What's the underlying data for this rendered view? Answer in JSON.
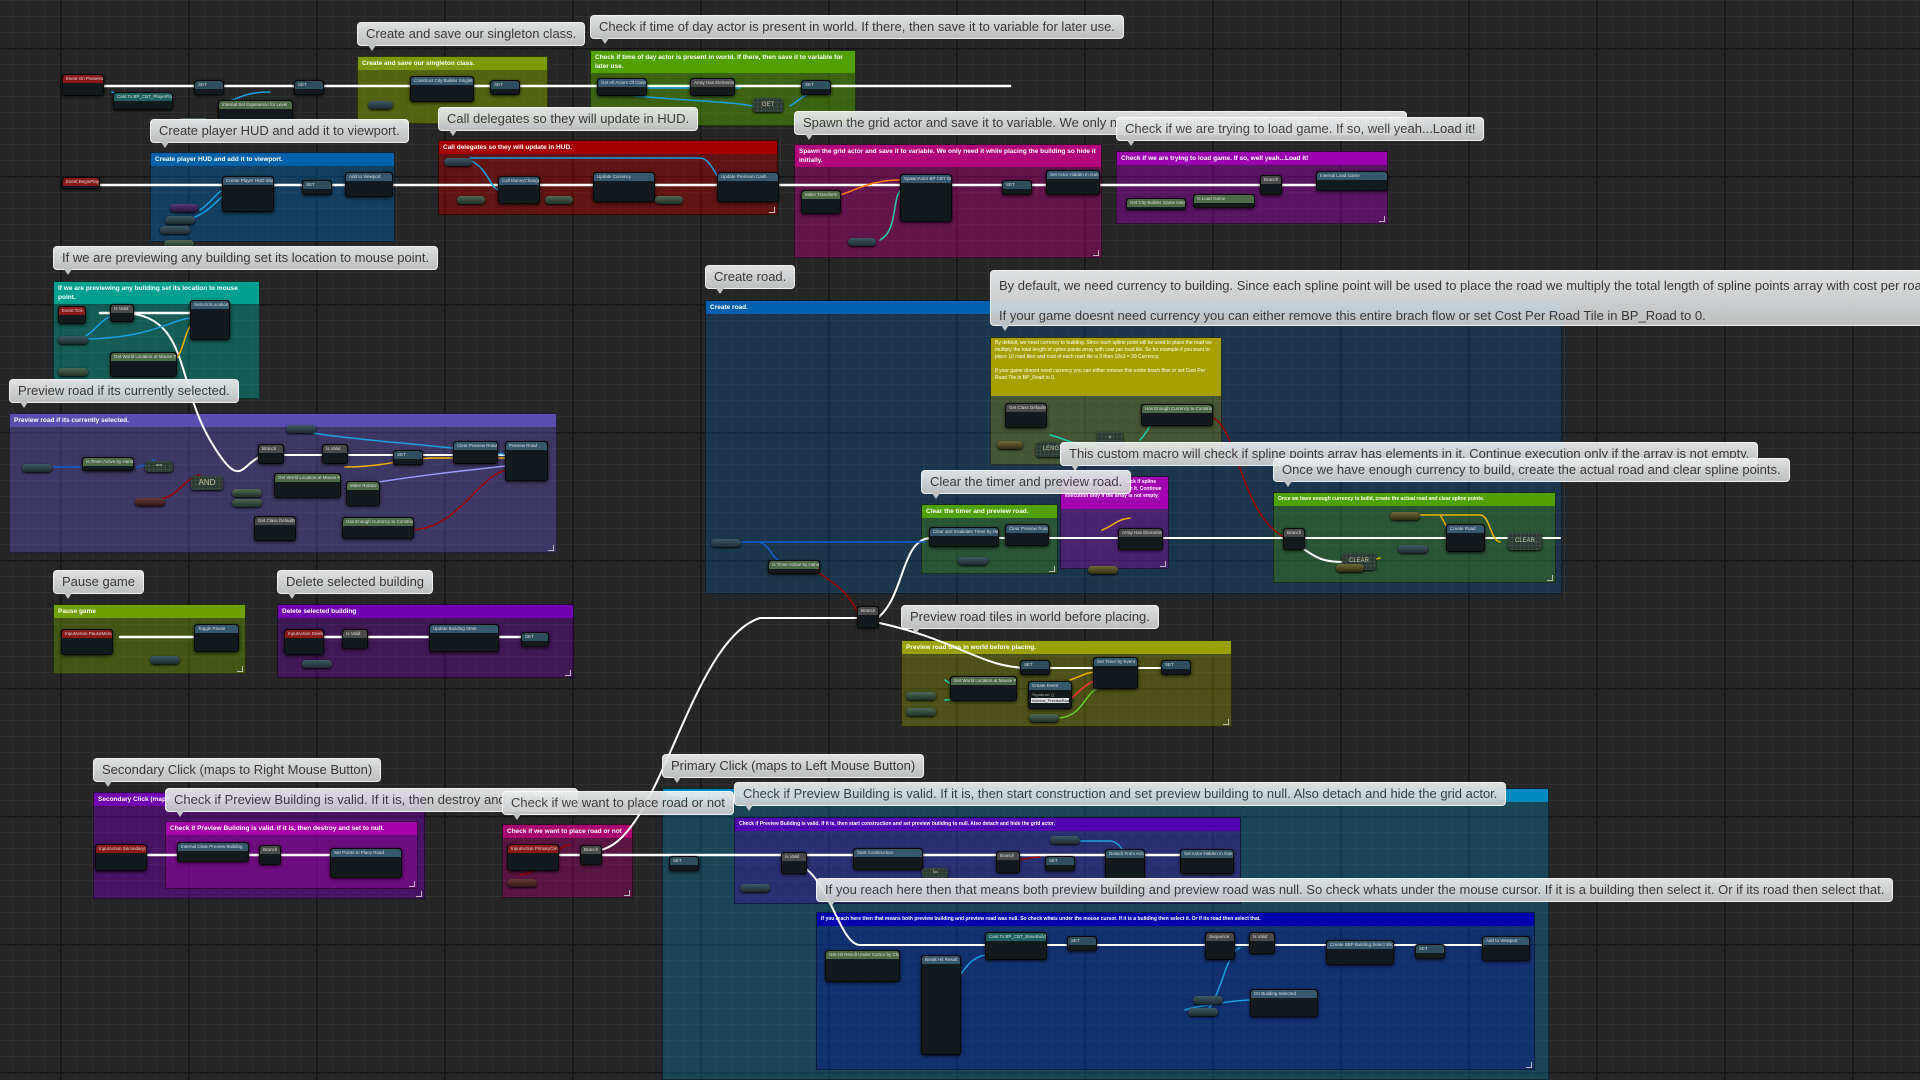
{
  "editor": {
    "type": "blueprint-event-graph"
  },
  "bubbles": [
    "Create and save our singleton class.",
    "Check if time of day actor is present in world. If there, then save it to variable for later use.",
    "Create player HUD and add it to viewport.",
    "Call delegates so they will update in HUD.",
    "Spawn the grid actor and save it to variable. We only need it while placing the building so hide it initially.",
    "Check if we are trying to load game. If so, well yeah...Load it!",
    "If we are previewing any building set its location to mouse point.",
    "Preview road if its currently selected.",
    "Create road.",
    "By default, we need currency to building. Since each spline point will be used to place the road we multiply the total length of spline points array with cost per road tile. So for example if you want to place 10 road tiles and cost of each road tile is 3 then 10x3 = 30 Currency.",
    "If your game doesnt need currency you can either remove this entire brach flow or set Cost Per Road Tile in BP_Road to 0.",
    "This custom macro will check if spline points array has elements in it. Continue execution only if the array is not empty.",
    "Once we have enough currency to build, create the actual road and clear spline points.",
    "Clear the timer and preview road.",
    "Pause game",
    "Delete selected building",
    "Preview road tiles in world before placing.",
    "Secondary Click (maps to Right Mouse Button)",
    "Check if Preview Building is valid. If it is, then destroy and set to null.",
    "Check if we want to place road or not",
    "Primary Click (maps to Left Mouse Button)",
    "Check if Preview Building is valid. If it is, then start construction and set preview building to null. Also detach and hide the grid actor.",
    "If you reach here then that means both preview building and preview road was null. So check whats under the mouse cursor. If it is a building then select it. Or if its road then select that."
  ],
  "comments": [
    {
      "title": "Create and save our singleton class.",
      "color": "#7a9a00"
    },
    {
      "title": "Check if time of day actor is present in world. If there, then save it to variable for later use.",
      "color": "#4fa000"
    },
    {
      "title": "Create player HUD and add it to viewport.",
      "color": "#0060a8"
    },
    {
      "title": "Call delegates so they will update in HUD.",
      "color": "#a80000"
    },
    {
      "title": "Spawn the grid actor and save it to variable. We only need it while placing the building so hide it initially.",
      "color": "#b0007a"
    },
    {
      "title": "Check if we are trying to load game. If so, well yeah...Load it!",
      "color": "#9a00b0"
    },
    {
      "title": "If we are previewing any building set its location to mouse point.",
      "color": "#00a090"
    },
    {
      "title": "Preview road if its currently selected.",
      "color": "#5a4fb0"
    },
    {
      "title": "Create road.",
      "color": "#0060b0"
    },
    {
      "title": "By default, we need currency to building. Since each spline point will be used to place the road we multiply the total length of spline points array with cost per road tile. So for example if you want to place 10 road tiles and cost of each road tile is 3 then 10x3 = 30 Currency.\n\nIf your game doesnt need currency you can either remove this entire brach flow or set Cost Per Road Tile in BP_Road to 0.",
      "color": "#a8a000"
    },
    {
      "title": "Clear the timer and preview road.",
      "color": "#4fa000"
    },
    {
      "title": "This custom macro will check if spline points array has elements in it. Continue execution only if the array is not empty.",
      "color": "#a000b0"
    },
    {
      "title": "Once we have enough currency to build, create the actual road and clear spline points.",
      "color": "#4fa000"
    },
    {
      "title": "Pause game",
      "color": "#70a000"
    },
    {
      "title": "Delete selected building",
      "color": "#7000b0"
    },
    {
      "title": "Preview road tiles in world before placing.",
      "color": "#98a000"
    },
    {
      "title": "Secondary Click (maps to Right Mouse Button)",
      "color": "#7000b0"
    },
    {
      "title": "Check if Preview Building is valid. If it is, then destroy and set to null.",
      "color": "#a800a8"
    },
    {
      "title": "Check if we want to place road or not",
      "color": "#a80070"
    },
    {
      "title": "Primary Click (maps to Left Mouse Button)",
      "color": "#0088c0"
    },
    {
      "title": "Check if Preview Building is valid. If it is, then start construction and set preview building to null. Also detach and hide the grid actor.",
      "color": "#5000b0"
    },
    {
      "title": "If you reach here then that means both preview building and preview road was null. So check whats under the mouse cursor. If it is a building then select it. Or if its road then select that.",
      "color": "#0000b0"
    }
  ],
  "nodes": {
    "event_possess": "Event On Possess",
    "cast_playerpawn": "Cast To BP_CBT_PlayerPawn",
    "set1": "SET",
    "internal_experience": "Internal Set Experience for Level",
    "set2": "SET",
    "construct_singleton": "Construct City Builder Singleton",
    "set3": "SET",
    "get_all_actors": "Get All Actors Of Class",
    "array_has_elements_1": "Array Has Elements",
    "get": "GET",
    "set4": "SET",
    "event_beginplay": "Event BeginPlay",
    "create_hud": "Create Player HUD Widget",
    "set5": "SET",
    "add_viewport": "Add to Viewport",
    "call_money_changed": "Call MoneyChanged",
    "update_currency": "Update Currency",
    "update_premium": "Update Premium Cash",
    "make_transform": "Make Transform",
    "spawn_grid": "SpawnActor BP CBT Grid",
    "set6": "SET",
    "set_hidden": "Set Actor Hidden In Game",
    "get_instance": "Get City Builder Game Instance",
    "is_load_game": "Is Load Game",
    "branch_load": "Branch",
    "internal_load": "Internal Load Game",
    "event_tick": "Event Tick",
    "is_valid_1": "Is Valid",
    "set_actor_location": "SetActorLocation",
    "get_world_loc_1": "Get World Location at Mouse Point",
    "timer_active": "Is Timer Active by Handle",
    "eq": "==",
    "and": "AND",
    "branch_preview": "Branch",
    "is_valid_2": "Is Valid",
    "set7": "SET",
    "clear_preview_road_1": "Clear Preview Road",
    "preview_road": "Preview Road",
    "get_world_loc_2": "Get World Location at Mouse Point",
    "make_rotator": "Make Rotator",
    "get_class_defaults_1": "Get Class Defaults",
    "has_enough_currency_1": "Has Enough Currency to Construct",
    "get_class_defaults_2": "Get Class Defaults",
    "has_enough_currency_2": "Has Enough Currency to Construct",
    "multiply": "×",
    "length": "LENGTH",
    "clear_timer": "Clear and Invalidate Timer by Handle",
    "clear_preview_road_2": "Clear Preview Road",
    "array_has_elements_2": "Array Has Elements",
    "branch_currency": "Branch",
    "create_road": "Create Road",
    "clear1": "CLEAR",
    "clear2": "CLEAR",
    "timer_active_2": "Is Timer Active by Handle",
    "branch_road": "Branch",
    "input_pause": "InputAction PauseMenu",
    "toggle_pause": "Toggle Pause",
    "input_delete": "InputAction Delete",
    "is_valid_3": "Is Valid",
    "update_building_state": "Update Building State",
    "set8": "SET",
    "set9": "SET",
    "set_timer": "Set Timer by Event",
    "get_world_loc_3": "Get World Location at Mouse Point",
    "create_event": "Create Event",
    "create_event_signature": "Signature: ()",
    "create_event_fn": "Internal_PreviewRoad()",
    "input_secondary": "InputAction SecondaryClick",
    "internal_clear_preview": "Internal Clear Preview Building",
    "branch_sec": "Branch",
    "set_points": "Set Points to Place Road",
    "input_primary": "InputAction PrimaryClick",
    "branch_prim": "Branch",
    "set10": "SET",
    "is_valid_4": "Is Valid",
    "start_construction": "Start Construction",
    "ne": "!=",
    "branch_pc": "Branch",
    "set11": "SET",
    "detach_actor": "Detach From Actor",
    "set_hidden_2": "Set Actor Hidden In Game",
    "get_hit_result": "Get Hit Result Under Cursor by Channel",
    "break_hit": "Break Hit Result",
    "cast_building": "Cast To BP_CBT_BaseBuilding",
    "set12": "SET",
    "sequence": "Sequence",
    "is_valid_5": "Is Valid",
    "create_select_widget": "Create BBP Building Select Widget",
    "set13": "SET",
    "add_viewport_2": "Add to Viewport",
    "on_building_selected": "On Building Selected",
    "add_pin": "Add pin +"
  }
}
